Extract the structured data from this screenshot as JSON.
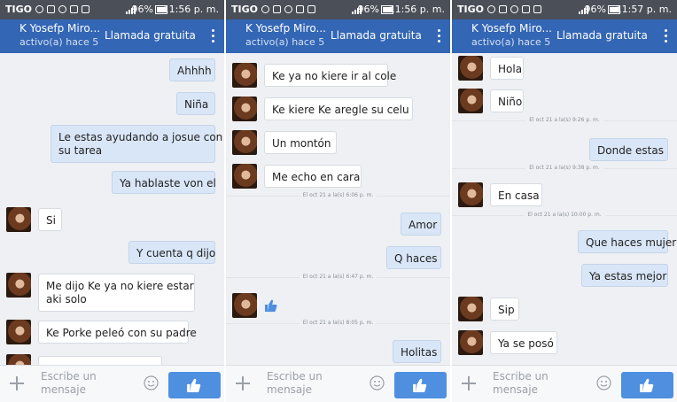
{
  "status_bar": {
    "carrier": "TIGO",
    "battery_pct": "96%"
  },
  "header": {
    "contact_name": "K Yosefp Miro...",
    "presence": "activo(a) hace 5",
    "call_label": "Llamada gratuita"
  },
  "composer": {
    "placeholder_line1": "Escribe un",
    "placeholder_line2": "mensaje"
  },
  "colors": {
    "header_blue": "#3366b4",
    "status_gray": "#4a4f58",
    "outgoing_bubble": "#d9e6f7",
    "like_button": "#4f8fe0"
  },
  "panels": [
    {
      "clock": "11:56 p. m.",
      "stamps": [],
      "messages": [
        {
          "side": "out",
          "text": "Ahhhh"
        },
        {
          "side": "out",
          "text": "Niña"
        },
        {
          "side": "out",
          "text": "Le estas ayudando a josue con",
          "text2": "su tarea"
        },
        {
          "side": "out",
          "text": "Ya hablaste von el"
        },
        {
          "side": "in",
          "text": "Si"
        },
        {
          "side": "out",
          "text": "Y cuenta q dijo"
        },
        {
          "side": "in",
          "text": "Me dijo Ke ya no kiere estar",
          "text2": "aki solo"
        },
        {
          "side": "in",
          "text": "Ke Porke peleó con su padre"
        }
      ]
    },
    {
      "clock": "11:56 p. m.",
      "stamps": [
        "El oct 21 a la(s) 6:06 p. m.",
        "El oct 21 a la(s) 6:47 p. m.",
        "El oct 21 a la(s) 8:05 p. m."
      ],
      "messages": [
        {
          "side": "in",
          "text": "Ke ya no kiere ir al cole"
        },
        {
          "side": "in",
          "text": "Ke kiere Ke aregle su celu"
        },
        {
          "side": "in",
          "text": "Un montón"
        },
        {
          "side": "in",
          "text": "Me echo en cara"
        },
        {
          "side": "out",
          "text": "Amor"
        },
        {
          "side": "out",
          "text": "Q haces"
        },
        {
          "side": "in",
          "text": "",
          "icon": "thumbs-up-icon"
        },
        {
          "side": "out",
          "text": "Holitas"
        }
      ]
    },
    {
      "clock": "11:57 p. m.",
      "stamps": [
        "El oct 21 a la(s) 9:26 p. m.",
        "El oct 21 a la(s) 9:38 p. m.",
        "El oct 21 a la(s) 10:00 p. m."
      ],
      "messages": [
        {
          "side": "in",
          "text": "Hola"
        },
        {
          "side": "in",
          "text": "Niño"
        },
        {
          "side": "out",
          "text": "Donde estas"
        },
        {
          "side": "in",
          "text": "En casa"
        },
        {
          "side": "out",
          "text": "Que haces mujer"
        },
        {
          "side": "out",
          "text": "Ya estas mejor"
        },
        {
          "side": "in",
          "text": "Sip"
        },
        {
          "side": "in",
          "text": "Ya se posó"
        }
      ]
    }
  ]
}
